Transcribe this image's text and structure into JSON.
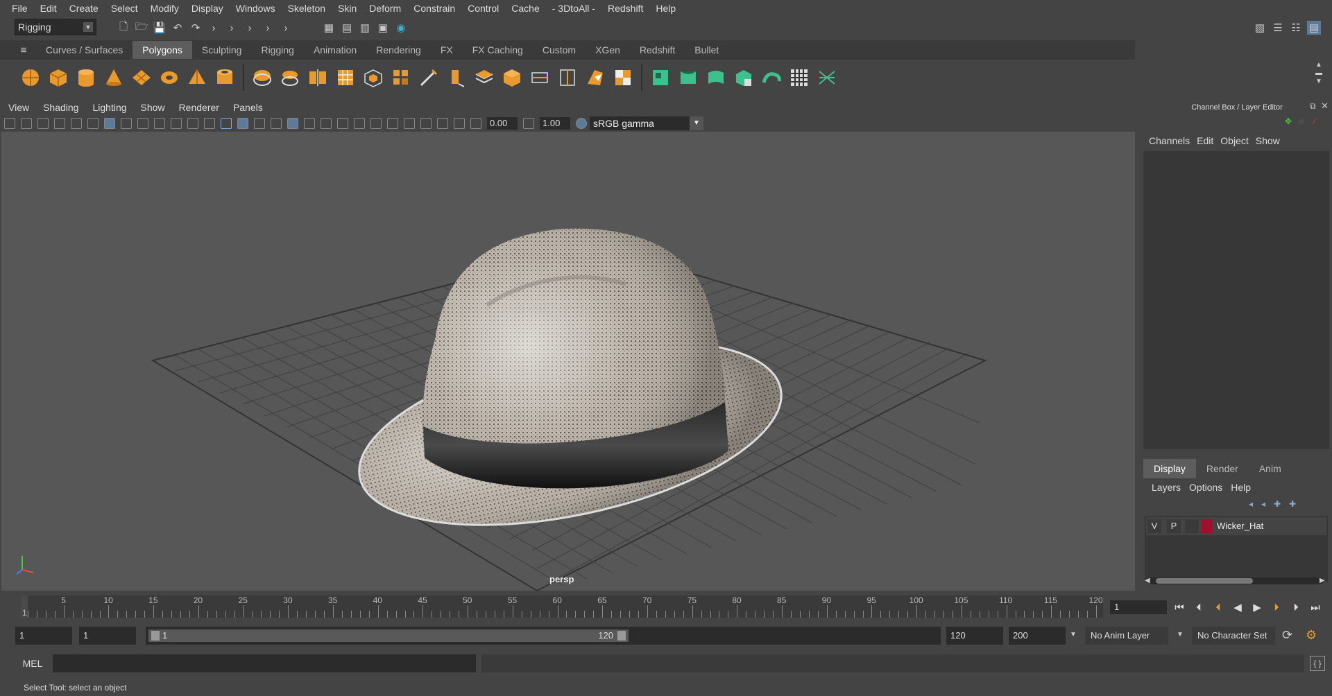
{
  "menubar": {
    "items": [
      "File",
      "Edit",
      "Create",
      "Select",
      "Modify",
      "Display",
      "Windows",
      "Skeleton",
      "Skin",
      "Deform",
      "Constrain",
      "Control",
      "Cache",
      "- 3DtoAll -",
      "Redshift",
      "Help"
    ]
  },
  "statusline": {
    "mode": "Rigging"
  },
  "shelf": {
    "tabs": [
      "Curves / Surfaces",
      "Polygons",
      "Sculpting",
      "Rigging",
      "Animation",
      "Rendering",
      "FX",
      "FX Caching",
      "Custom",
      "XGen",
      "Redshift",
      "Bullet"
    ],
    "active_tab": "Polygons",
    "icons": [
      "poly-sphere-icon",
      "poly-cube-icon",
      "poly-cylinder-icon",
      "poly-cone-icon",
      "poly-plane-icon",
      "poly-torus-icon",
      "poly-pyramid-icon",
      "poly-pipe-icon",
      "combine-icon",
      "separate-icon",
      "mirror-icon",
      "smooth-icon",
      "extrude-icon",
      "bridge-icon",
      "multi-cut-icon",
      "target-weld-icon",
      "bevel-icon",
      "fill-hole-icon",
      "append-icon",
      "insert-loop-icon",
      "merge-icon",
      "uv-planar-icon",
      "uv-cylindrical-icon",
      "uv-spherical-icon",
      "uv-auto-icon",
      "uv-editor-icon",
      "uv-unfold-icon",
      "uv-checker-icon",
      "uv-layout-icon"
    ],
    "colors": {
      "orange": "#e89a2c",
      "green": "#3dbf8e"
    }
  },
  "panel": {
    "menu": [
      "View",
      "Shading",
      "Lighting",
      "Show",
      "Renderer",
      "Panels"
    ],
    "exposure": "0.00",
    "gamma": "1.00",
    "colorspace": "sRGB gamma",
    "camera_label": "persp"
  },
  "channelbox": {
    "title": "Channel Box / Layer Editor",
    "menu": [
      "Channels",
      "Edit",
      "Object",
      "Show"
    ]
  },
  "layereditor": {
    "tabs": [
      "Display",
      "Render",
      "Anim"
    ],
    "active_tab": "Display",
    "menu": [
      "Layers",
      "Options",
      "Help"
    ],
    "layers": [
      {
        "v": "V",
        "p": "P",
        "name": "Wicker_Hat",
        "color": "#a0102a"
      }
    ]
  },
  "timeline": {
    "ticks": [
      "5",
      "10",
      "15",
      "20",
      "25",
      "30",
      "35",
      "40",
      "45",
      "50",
      "55",
      "60",
      "65",
      "70",
      "75",
      "80",
      "85",
      "90",
      "95",
      "100",
      "105",
      "110",
      "115",
      "120"
    ],
    "start_marker": "1",
    "current_frame": "1"
  },
  "range": {
    "start": "1",
    "start_playback": "1",
    "slider_start": "1",
    "slider_end": "120",
    "end_playback": "120",
    "end": "200",
    "anim_layer": "No Anim Layer",
    "character_set": "No Character Set"
  },
  "cmd": {
    "mel_label": "MEL"
  },
  "help": {
    "text": "Select Tool: select an object"
  }
}
